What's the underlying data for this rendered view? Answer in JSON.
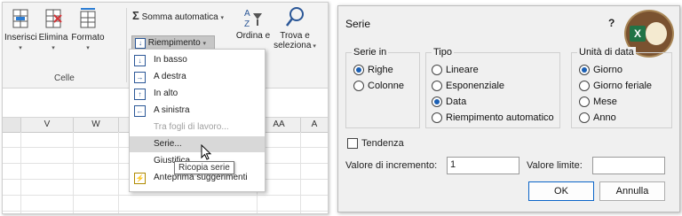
{
  "ribbon": {
    "insert": "Inserisci",
    "delete": "Elimina",
    "format": "Formato",
    "cells_group": "Celle",
    "autosum": "Somma automatica",
    "fill": "Riempimento",
    "sort_partial": "Ordina e",
    "find_1": "Trova e",
    "find_2": "seleziona"
  },
  "columns": [
    "V",
    "W",
    "AA",
    "A"
  ],
  "menu": {
    "items": [
      {
        "label": "In basso",
        "icon": "arrow-down-icon"
      },
      {
        "label": "A destra",
        "icon": "arrow-right-icon"
      },
      {
        "label": "In alto",
        "icon": "arrow-up-icon"
      },
      {
        "label": "A sinistra",
        "icon": "arrow-left-icon"
      },
      {
        "label": "Tra fogli di lavoro...",
        "disabled": true
      },
      {
        "label": "Serie...",
        "selected": true
      },
      {
        "label": "Giustifica"
      },
      {
        "label": "Anteprima suggerimenti",
        "icon": "flash-fill-icon"
      }
    ],
    "tooltip": "Ricopia serie"
  },
  "dialog": {
    "title": "Serie",
    "help": "?",
    "group_series_in": "Serie in",
    "rows": "Righe",
    "columns": "Colonne",
    "series_in_selected": "Righe",
    "group_type": "Tipo",
    "type_options": [
      "Lineare",
      "Esponenziale",
      "Data",
      "Riempimento automatico"
    ],
    "type_selected": "Data",
    "group_date_unit": "Unità di data",
    "date_options": [
      "Giorno",
      "Giorno feriale",
      "Mese",
      "Anno"
    ],
    "date_selected": "Giorno",
    "trend": "Tendenza",
    "step_label": "Valore di incremento:",
    "step_value": "1",
    "stop_label": "Valore limite:",
    "stop_value": "",
    "ok": "OK",
    "cancel": "Annulla"
  },
  "colors": {
    "accent": "#1a5fb4",
    "excel_green": "#217346"
  }
}
